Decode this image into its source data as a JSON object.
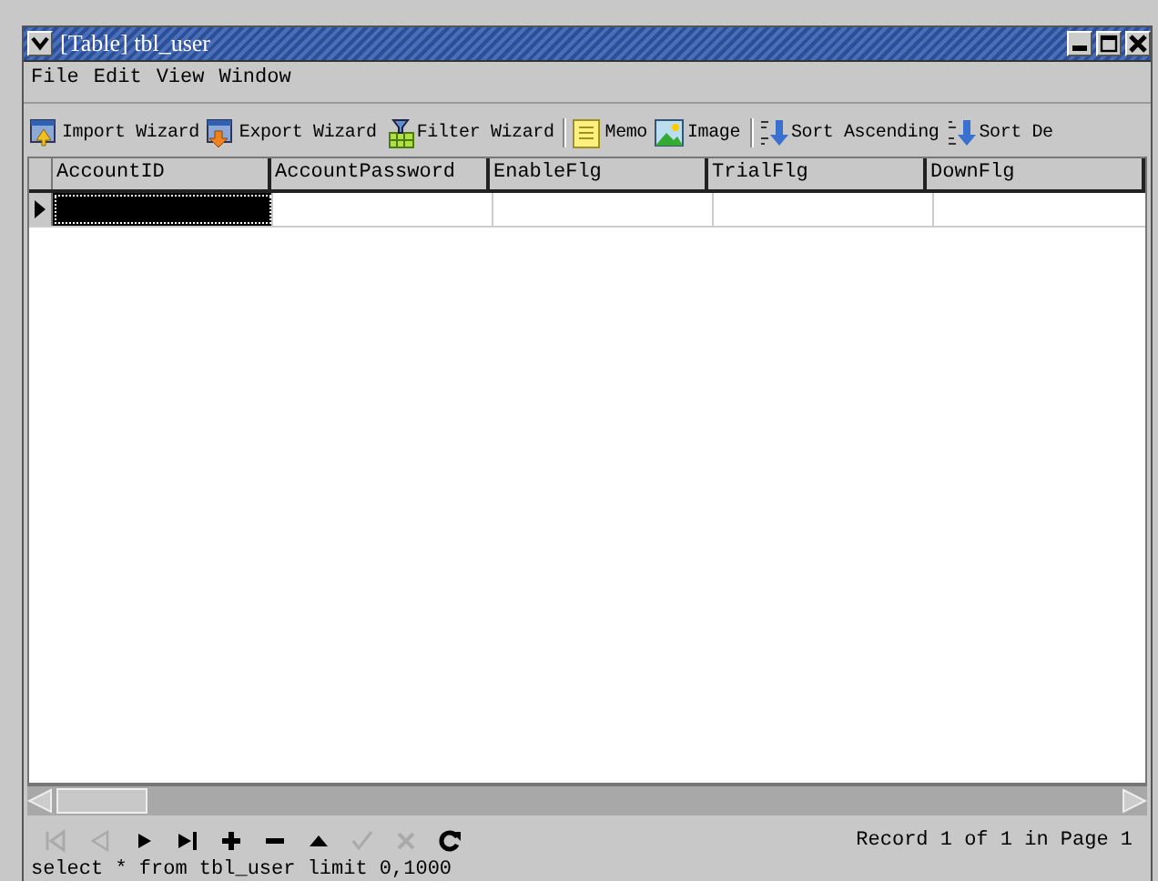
{
  "window": {
    "title": "[Table] tbl_user"
  },
  "menu": [
    "File",
    "Edit",
    "View",
    "Window"
  ],
  "toolbar": [
    [
      "Import Wizard",
      "Export Wizard",
      "Filter Wizard"
    ],
    [
      "Memo",
      "Image"
    ],
    [
      "Sort Ascending",
      "Sort De"
    ]
  ],
  "table": {
    "columns": [
      "AccountID",
      "AccountPassword",
      "EnableFlg",
      "TrialFlg",
      "DownFlg"
    ],
    "rows": [
      {
        "selected": true
      }
    ]
  },
  "navigator": [
    {
      "disabled": true
    },
    {
      "disabled": true
    },
    {
      "disabled": false
    },
    {
      "disabled": false
    },
    {
      "disabled": false
    },
    {
      "disabled": false
    },
    {
      "disabled": false
    },
    {
      "disabled": true
    },
    {
      "disabled": true
    },
    {
      "disabled": false
    }
  ],
  "status": "Record 1 of 1 in Page 1",
  "sql": "select * from tbl_user limit 0,1000"
}
